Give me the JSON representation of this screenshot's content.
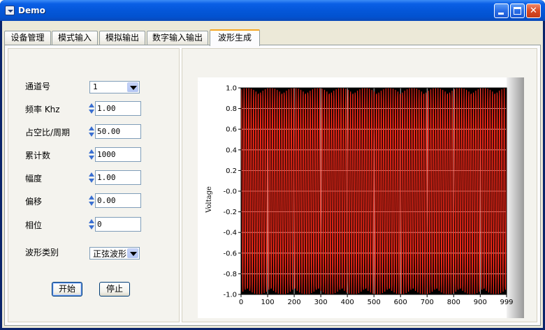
{
  "window": {
    "title": "Demo"
  },
  "tabs": [
    {
      "label": "设备管理",
      "active": false
    },
    {
      "label": "模式输入",
      "active": false
    },
    {
      "label": "模拟输出",
      "active": false
    },
    {
      "label": "数字输入输出",
      "active": false
    },
    {
      "label": "波形生成",
      "active": true
    }
  ],
  "form": {
    "channel_label": "通道号",
    "channel_value": "1",
    "frequency_label": "频率 Khz",
    "frequency_value": "1.00",
    "duty_label": "占空比/周期",
    "duty_value": "50.00",
    "count_label": "累计数",
    "count_value": "1000",
    "amplitude_label": "幅度",
    "amplitude_value": "1.00",
    "offset_label": "偏移",
    "offset_value": "0.00",
    "phase_label": "相位",
    "phase_value": "0",
    "waveform_label": "波形类别",
    "waveform_value": "正弦波形",
    "start_label": "开始",
    "stop_label": "停止"
  },
  "chart_data": {
    "type": "line",
    "ylabel": "Voltage",
    "xlabel": "",
    "xlim": [
      0,
      999
    ],
    "ylim": [
      -1.0,
      1.0
    ],
    "x_ticks": [
      "0",
      "100",
      "200",
      "300",
      "400",
      "500",
      "600",
      "700",
      "800",
      "900",
      "999"
    ],
    "y_ticks": [
      "1.0",
      "0.8",
      "0.6",
      "0.4",
      "0.2",
      "-0.0",
      "-0.2",
      "-0.4",
      "-0.6",
      "-0.8",
      "-1.0"
    ],
    "series": [
      {
        "waveform": "sine",
        "amplitude": 1.0,
        "offset": 0.0,
        "samples": 1000,
        "period_samples": 8.9,
        "color": "#ff2a1a"
      }
    ],
    "grid": true,
    "background": "#000000",
    "grid_color": "#ffffff"
  }
}
